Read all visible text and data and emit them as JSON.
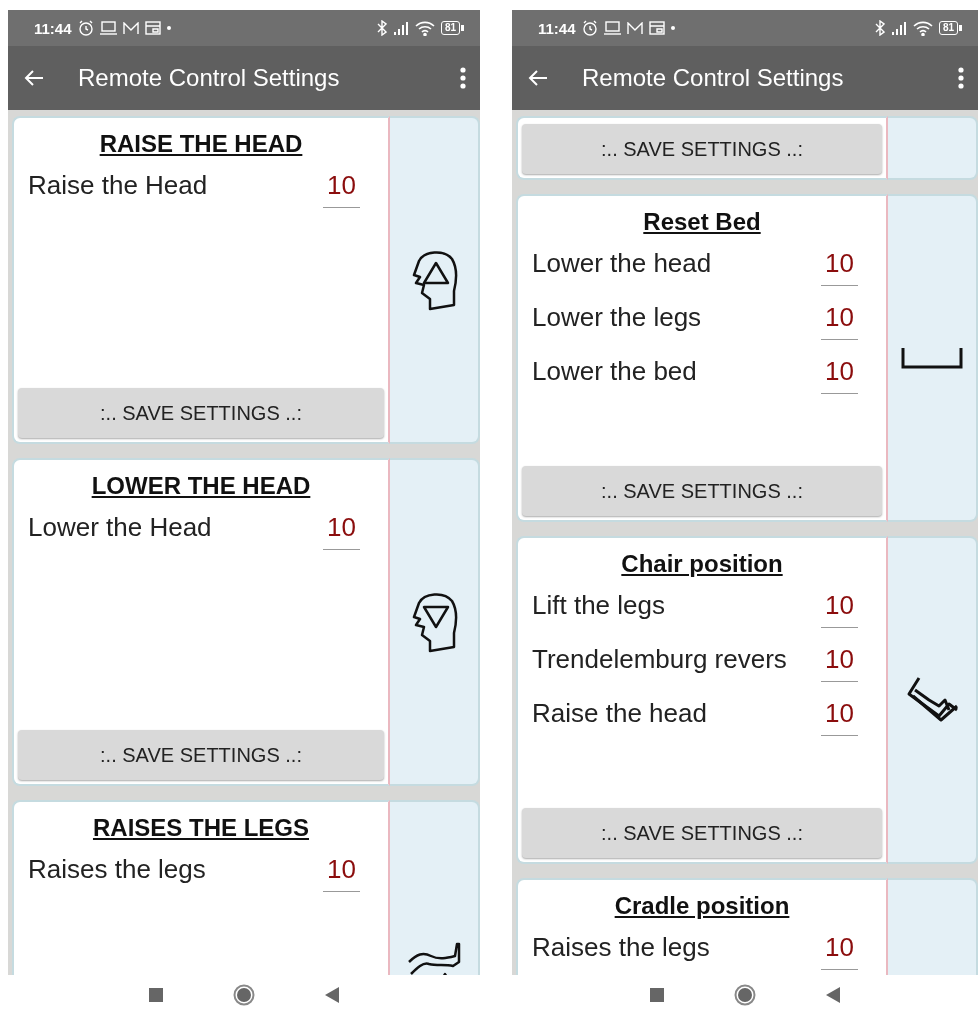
{
  "phones": [
    {
      "status_bar": {
        "time": "11:44",
        "battery": "81"
      },
      "app_bar": {
        "title": "Remote Control Settings"
      },
      "cards": [
        {
          "title": "RAISE THE HEAD",
          "kind": "head-up",
          "rows": [
            {
              "label": "Raise the Head",
              "value": "10"
            }
          ],
          "save_button": ":.. SAVE SETTINGS ..:"
        },
        {
          "title": "LOWER THE HEAD",
          "kind": "head-down",
          "rows": [
            {
              "label": "Lower the Head",
              "value": "10"
            }
          ],
          "save_button": ":.. SAVE SETTINGS ..:"
        },
        {
          "title": "RAISES THE LEGS",
          "kind": "legs",
          "rows": [
            {
              "label": "Raises the legs",
              "value": "10"
            }
          ]
        }
      ]
    },
    {
      "status_bar": {
        "time": "11:44",
        "battery": "81"
      },
      "app_bar": {
        "title": "Remote Control Settings"
      },
      "cards": [
        {
          "save_button": ":.. SAVE SETTINGS ..:"
        },
        {
          "title": "Reset Bed",
          "kind": "bed-flat",
          "rows": [
            {
              "label": "Lower the head",
              "value": "10"
            },
            {
              "label": "Lower the legs",
              "value": "10"
            },
            {
              "label": "Lower the bed",
              "value": "10"
            }
          ],
          "save_button": ":.. SAVE SETTINGS ..:"
        },
        {
          "title": "Chair position",
          "kind": "bed-chair",
          "rows": [
            {
              "label": "Lift the legs",
              "value": "10"
            },
            {
              "label": "Trendelemburg revers",
              "value": "10"
            },
            {
              "label": "Raise the head",
              "value": "10"
            }
          ],
          "save_button": ":.. SAVE SETTINGS ..:"
        },
        {
          "title": "Cradle position",
          "rows": [
            {
              "label": "Raises the legs",
              "value": "10"
            }
          ]
        }
      ]
    }
  ]
}
